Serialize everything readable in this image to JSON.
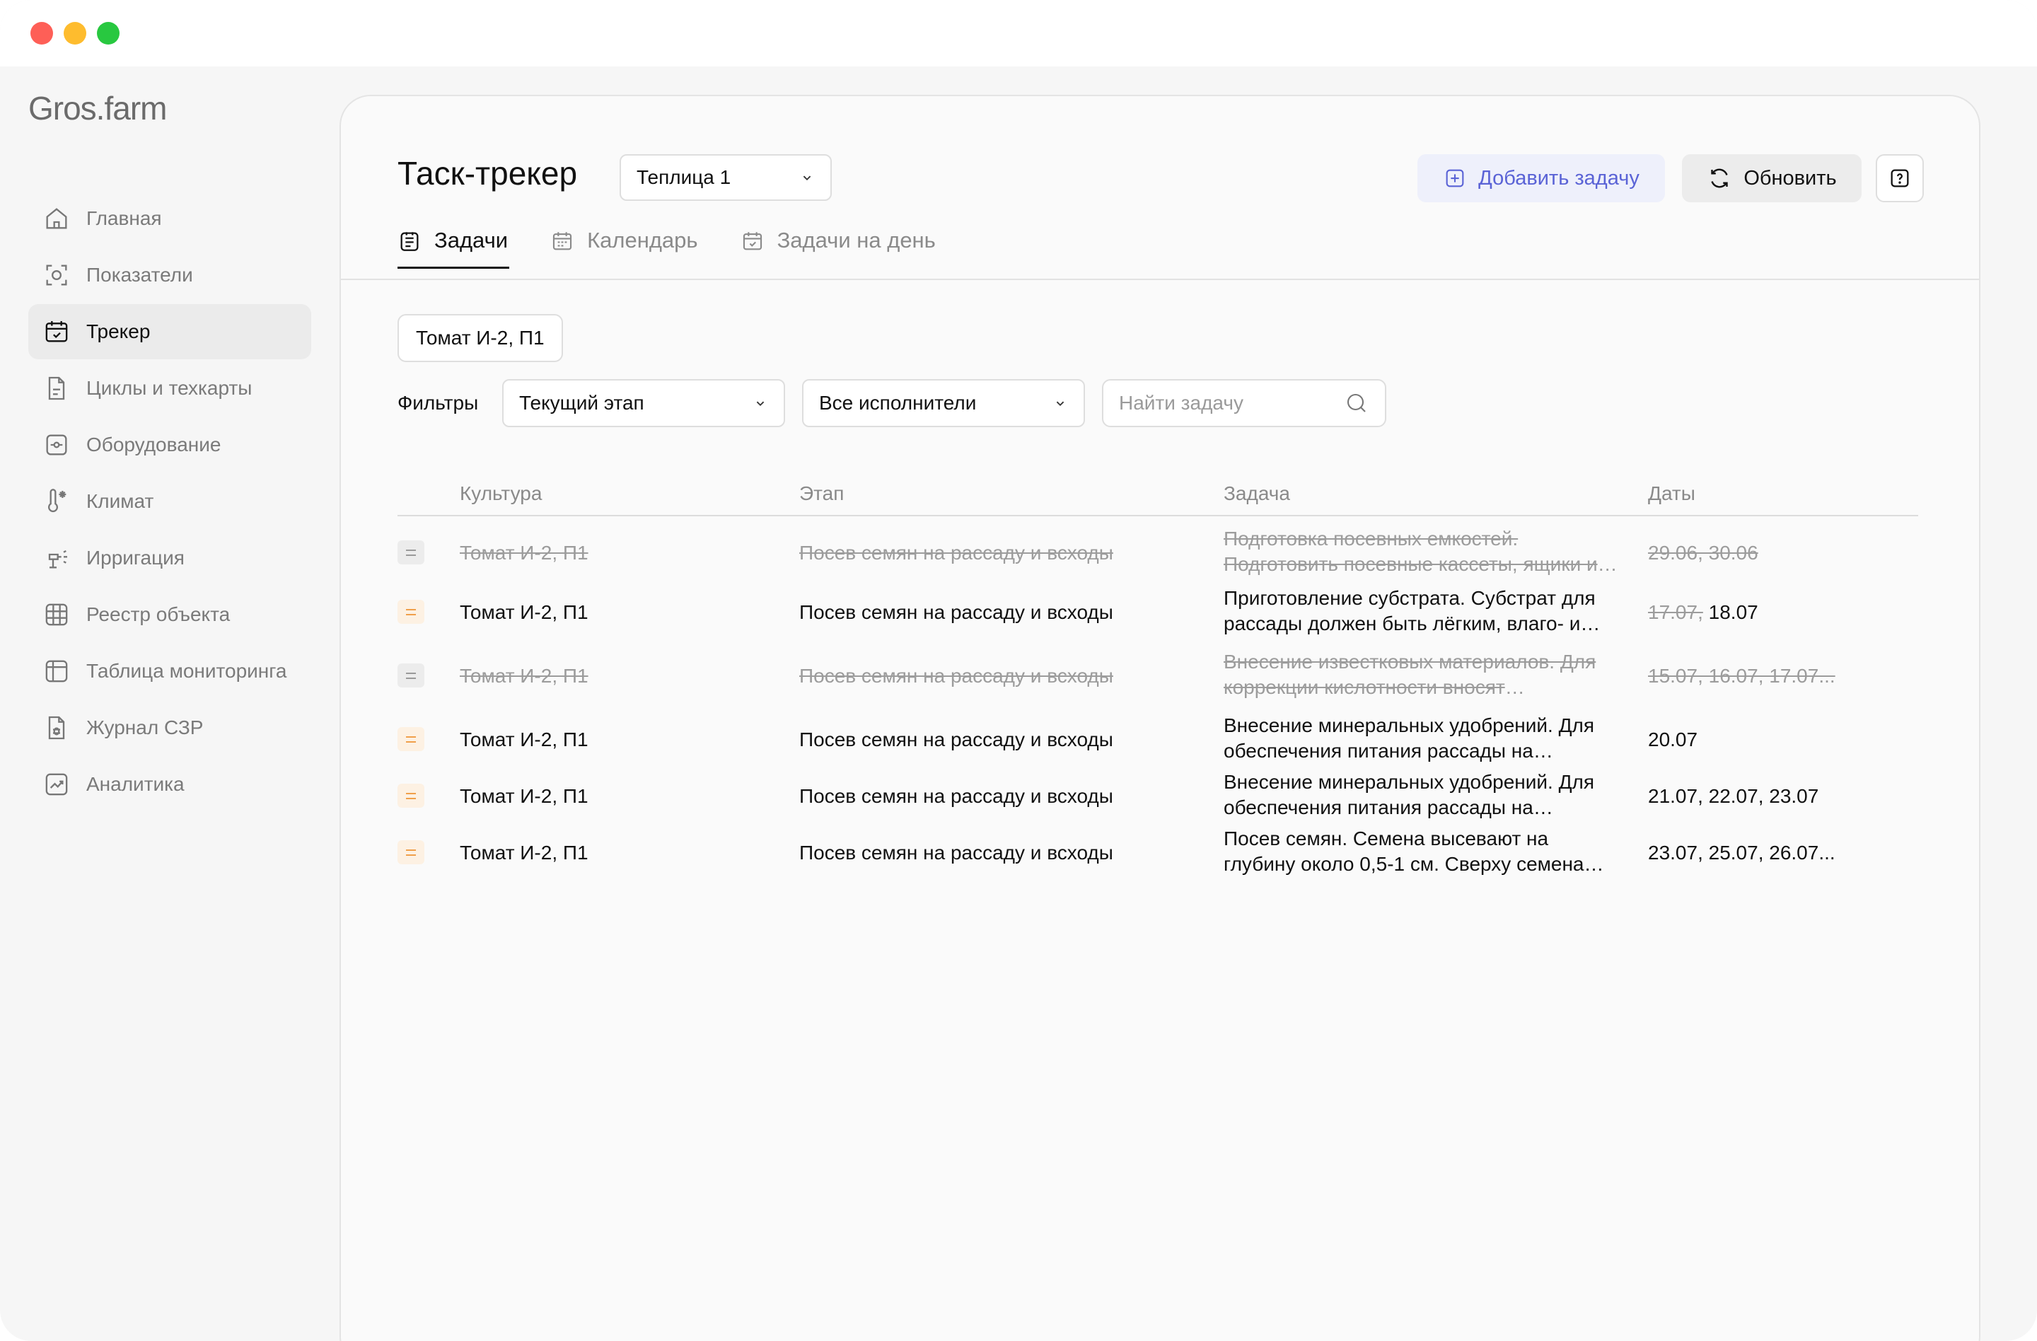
{
  "app": {
    "logo": "Gros.farm"
  },
  "sidebar": {
    "items": [
      {
        "label": "Главная",
        "icon": "home-icon"
      },
      {
        "label": "Показатели",
        "icon": "metrics-icon"
      },
      {
        "label": "Трекер",
        "icon": "calendar-check-icon",
        "active": true
      },
      {
        "label": "Циклы и техкарты",
        "icon": "document-icon"
      },
      {
        "label": "Оборудование",
        "icon": "equipment-icon"
      },
      {
        "label": "Климат",
        "icon": "thermometer-icon"
      },
      {
        "label": "Ирригация",
        "icon": "sprinkler-icon"
      },
      {
        "label": "Реестр объекта",
        "icon": "grid-icon"
      },
      {
        "label": "Таблица мониторинга",
        "icon": "table-icon"
      },
      {
        "label": "Журнал СЗР",
        "icon": "bug-document-icon"
      },
      {
        "label": "Аналитика",
        "icon": "chart-icon"
      }
    ]
  },
  "header": {
    "title": "Таск-трекер",
    "greenhouse_select": "Теплица 1",
    "add_task_label": "Добавить задачу",
    "refresh_label": "Обновить"
  },
  "tabs": [
    {
      "label": "Задачи",
      "active": true
    },
    {
      "label": "Календарь"
    },
    {
      "label": "Задачи на день"
    }
  ],
  "chip": "Томат И-2, П1",
  "filters": {
    "label": "Фильтры",
    "stage": "Текущий этап",
    "executors": "Все исполнители",
    "search_placeholder": "Найти задачу"
  },
  "table": {
    "columns": [
      "Культура",
      "Этап",
      "Задача",
      "Даты"
    ],
    "rows": [
      {
        "culture": "Томат И-2, П1",
        "stage": "Посев семян на рассаду и всходы",
        "task": "Подготовка посевных емкостей. Подготовить посевные кассеты, ящики и другие емкости",
        "dates_done": "",
        "dates": "29.06, 30.06",
        "done": true
      },
      {
        "culture": "Томат И-2, П1",
        "stage": "Посев семян на рассаду и всходы",
        "task": "Приготовление субстрата. Субстрат для рассады должен быть лёгким, влаго- и воздухопроницаемым",
        "dates_done": "17.07,",
        "dates": "18.07",
        "done": false
      },
      {
        "culture": "Томат И-2, П1",
        "stage": "Посев семян на рассаду и всходы",
        "task": "Внесение известковых материалов. Для коррекции кислотности вносят доломитовую муку",
        "dates_done": "",
        "dates": "15.07, 16.07, 17.07...",
        "done": true
      },
      {
        "culture": "Томат И-2, П1",
        "stage": "Посев семян на рассаду и всходы",
        "task": "Внесение минеральных удобрений. Для обеспечения питания рассады на начальном этапе",
        "dates_done": "",
        "dates": "20.07",
        "done": false
      },
      {
        "culture": "Томат И-2, П1",
        "stage": "Посев семян на рассаду и всходы",
        "task": "Внесение минеральных удобрений. Для обеспечения питания рассады на начальном этапе",
        "dates_done": "",
        "dates": "21.07, 22.07, 23.07",
        "done": false
      },
      {
        "culture": "Томат И-2, П1",
        "stage": "Посев семян на рассаду и всходы",
        "task": "Посев семян. Семена высевают на глубину около 0,5-1 см. Сверху семена присыпают субстратом",
        "dates_done": "",
        "dates": "23.07, 25.07, 26.07...",
        "done": false
      }
    ]
  }
}
